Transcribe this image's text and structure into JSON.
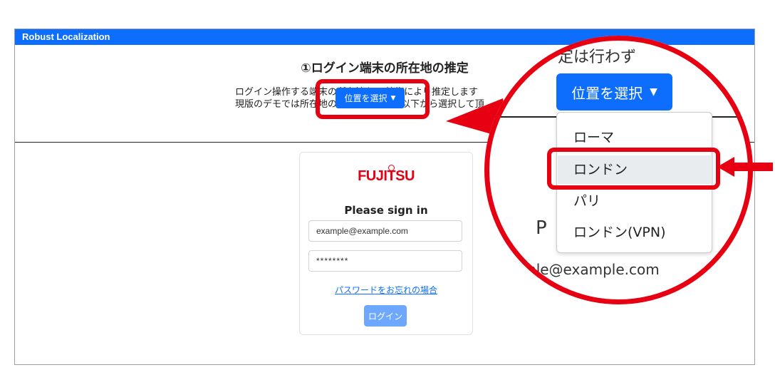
{
  "app": {
    "title": "Robust Localization"
  },
  "section": {
    "heading": "①ログイン端末の所在地の推定",
    "desc_line1": "ログイン操作する端末の所在地をRL技術により推定します",
    "desc_line2": "現版のデモでは所在地の推定は行わず、以下から選択して頂"
  },
  "location_select": {
    "label": "位置を選択"
  },
  "login_card": {
    "logo": "FUJITSU",
    "title": "Please sign in",
    "email_value": "example@example.com",
    "password_value": "********",
    "forgot_link": "パスワードをお忘れの場合",
    "login_button": "ログイン"
  },
  "magnifier": {
    "top_text": "定は行わず",
    "select_label": "位置を選択",
    "menu_items": [
      "ローマ",
      "ロンドン",
      "パリ",
      "ロンドン(VPN)"
    ],
    "behind_char": "P",
    "email_fragment": "ple@example.com"
  },
  "colors": {
    "primary": "#0d6efd",
    "primary_disabled": "#6ea8fe",
    "highlight_red": "#e60012",
    "brand_red": "#e60012"
  }
}
